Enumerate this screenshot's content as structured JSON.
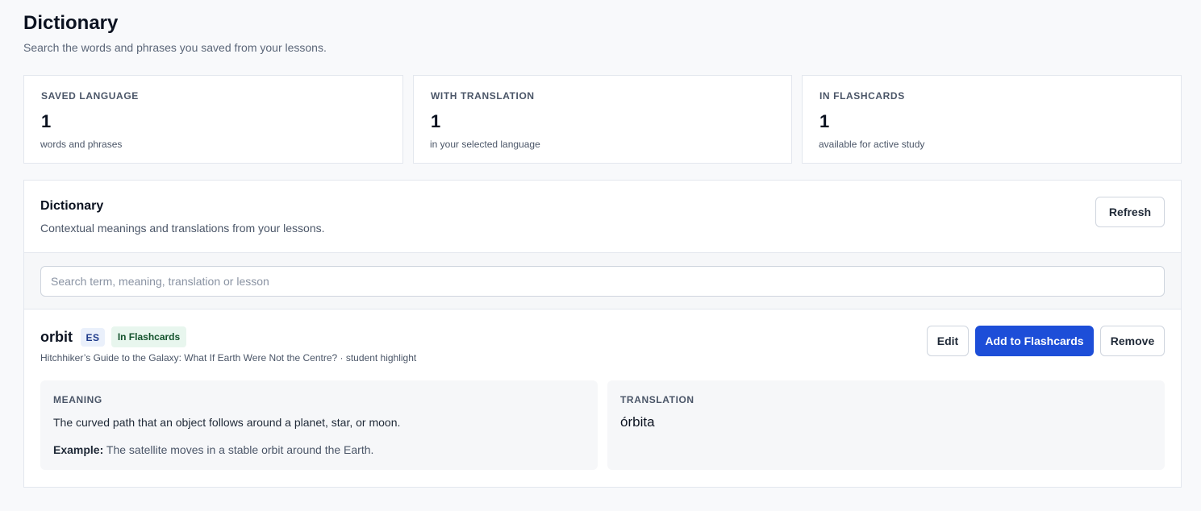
{
  "page": {
    "title": "Dictionary",
    "subtitle": "Search the words and phrases you saved from your lessons."
  },
  "stats": [
    {
      "label": "SAVED LANGUAGE",
      "value": "1",
      "note": "words and phrases"
    },
    {
      "label": "WITH TRANSLATION",
      "value": "1",
      "note": "in your selected language"
    },
    {
      "label": "IN FLASHCARDS",
      "value": "1",
      "note": "available for active study"
    }
  ],
  "panel": {
    "title": "Dictionary",
    "subtitle": "Contextual meanings and translations from your lessons.",
    "refresh_label": "Refresh",
    "search_placeholder": "Search term, meaning, translation or lesson",
    "search_value": ""
  },
  "entry": {
    "term": "orbit",
    "language_badge": "ES",
    "flashcard_badge": "In Flashcards",
    "source": "Hitchhiker’s Guide to the Galaxy: What If Earth Were Not the Centre? · student highlight",
    "edit_label": "Edit",
    "add_label": "Add to Flashcards",
    "remove_label": "Remove",
    "meaning_label": "MEANING",
    "meaning": "The curved path that an object follows around a planet, star, or moon.",
    "example_label": "Example:",
    "example": "The satellite moves in a stable orbit around the Earth.",
    "translation_label": "TRANSLATION",
    "translation": "órbita"
  },
  "colors": {
    "background": "#f8f9fb",
    "primary": "#1d4ed8",
    "badge_lang_bg": "#eaf0fb",
    "badge_flash_bg": "#e8f6ee"
  }
}
